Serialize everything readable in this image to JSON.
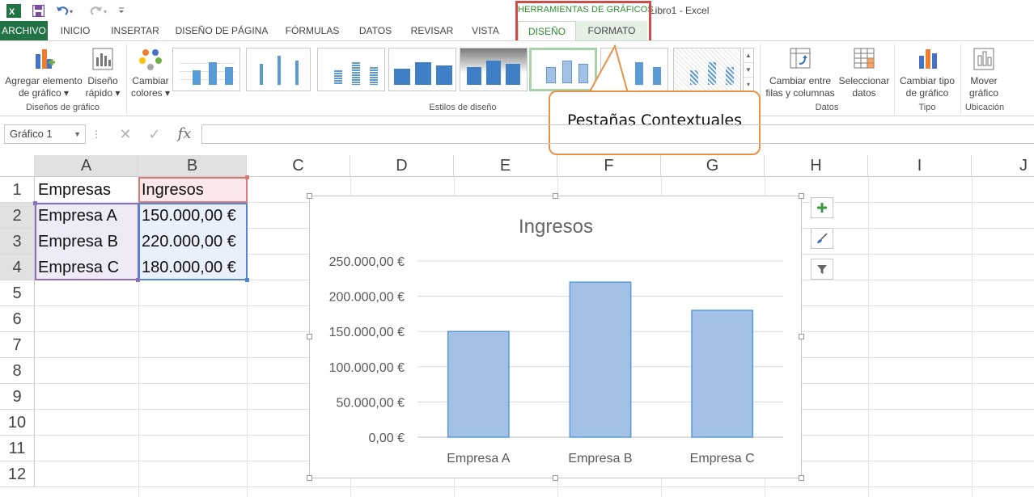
{
  "title_bar": {
    "app_title": "Libro1 - Excel",
    "context_group": "HERRAMIENTAS DE GRÁFICOS",
    "quick_access": [
      "excel-logo",
      "save",
      "undo",
      "redo",
      "customize"
    ]
  },
  "tabs": [
    {
      "label": "ARCHIVO"
    },
    {
      "label": "INICIO"
    },
    {
      "label": "INSERTAR"
    },
    {
      "label": "DISEÑO DE PÁGINA"
    },
    {
      "label": "FÓRMULAS"
    },
    {
      "label": "DATOS"
    },
    {
      "label": "REVISAR"
    },
    {
      "label": "VISTA"
    }
  ],
  "context_tabs": {
    "diseno": "DISEÑO",
    "formato": "FORMATO"
  },
  "ribbon": {
    "add_element": {
      "line1": "Agregar elemento",
      "line2": "de gráfico ▾"
    },
    "quick_layout": {
      "line1": "Diseño",
      "line2": "rápido ▾"
    },
    "change_colors": {
      "line1": "Cambiar",
      "line2": "colores ▾"
    },
    "group_layouts": "Diseños de gráfico",
    "group_styles": "Estilos de diseño",
    "switch_rowcol": {
      "line1": "Cambiar entre",
      "line2": "filas y columnas"
    },
    "select_data": {
      "line1": "Seleccionar",
      "line2": "datos"
    },
    "group_data": "Datos",
    "change_type": {
      "line1": "Cambiar tipo",
      "line2": "de gráfico"
    },
    "group_type": "Tipo",
    "move_chart": {
      "line1": "Mover",
      "line2": "gráfico"
    },
    "group_location": "Ubicación"
  },
  "formula_bar": {
    "name_box": "Gráfico 1",
    "cancel": "✕",
    "enter": "✓",
    "fx": "fx",
    "formula": ""
  },
  "columns": [
    "A",
    "B",
    "C",
    "D",
    "E",
    "F",
    "G",
    "H",
    "I",
    "J"
  ],
  "rows": [
    "1",
    "2",
    "3",
    "4",
    "5",
    "6",
    "7",
    "8",
    "9",
    "10",
    "11",
    "12"
  ],
  "cells": {
    "A1": "Empresas",
    "B1": "Ingresos",
    "A2": "Empresa A",
    "B2": "150.000,00 €",
    "A3": "Empresa B",
    "B3": "220.000,00 €",
    "A4": "Empresa C",
    "B4": "180.000,00 €"
  },
  "chart_data": {
    "type": "bar",
    "title": "Ingresos",
    "categories": [
      "Empresa A",
      "Empresa B",
      "Empresa C"
    ],
    "series": [
      {
        "name": "Ingresos",
        "values": [
          150000,
          220000,
          180000
        ]
      }
    ],
    "ylim": [
      0,
      250000
    ],
    "yticks": [
      0,
      50000,
      100000,
      150000,
      200000,
      250000
    ],
    "ytick_labels": [
      "0,00 €",
      "50.000,00 €",
      "100.000,00 €",
      "150.000,00 €",
      "200.000,00 €",
      "250.000,00 €"
    ],
    "grid": true,
    "legend": "none",
    "bar_color": "#a3c1e6",
    "bar_border": "#5b9bd5"
  },
  "chart_buttons": [
    "plus-icon",
    "brush-icon",
    "filter-icon"
  ],
  "callout": {
    "text": "Pestañas Contextuales"
  },
  "colors": {
    "excel_green": "#217346",
    "context_green": "#2e8b2e",
    "highlight_red": "#d34a4a",
    "callout_orange": "#e5924a"
  }
}
